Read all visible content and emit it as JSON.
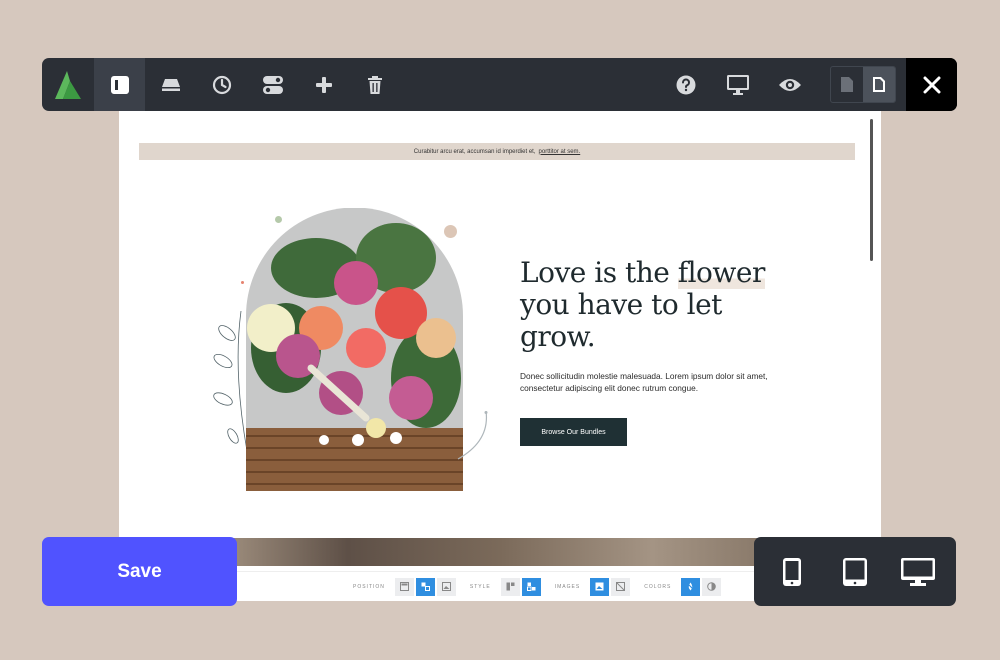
{
  "canvas": {
    "announcement": {
      "text": "Curabitur arcu erat, accumsan id imperdiet et,",
      "link": "porttitor at sem."
    },
    "hero": {
      "title_line1": "Love is the ",
      "title_highlight": "flower",
      "title_line2": "you have to let",
      "title_line3": "grow.",
      "body": "Donec sollicitudin molestie malesuada. Lorem ipsum dolor sit amet, consectetur adipiscing elit donec rutrum congue.",
      "cta_label": "Browse Our Bundles"
    },
    "controls": {
      "position_label": "POSITION",
      "style_label": "STYLE",
      "images_label": "IMAGES",
      "colors_label": "COLORS"
    }
  },
  "save_label": "Save",
  "colors": {
    "toolbar": "#2b2f36",
    "save": "#5053ff",
    "accent_blue": "#2f8ee0",
    "page_bg": "#d6c8be"
  },
  "toolbar_icons": [
    "logo-icon",
    "sidebar-icon",
    "drive-icon",
    "clock-icon",
    "toggles-icon",
    "plus-icon",
    "trash-icon",
    "help-icon",
    "monitor-icon",
    "eye-icon",
    "document-icon",
    "document-active-icon",
    "close-icon"
  ],
  "device_icons": [
    "phone-icon",
    "tablet-icon",
    "desktop-icon"
  ]
}
